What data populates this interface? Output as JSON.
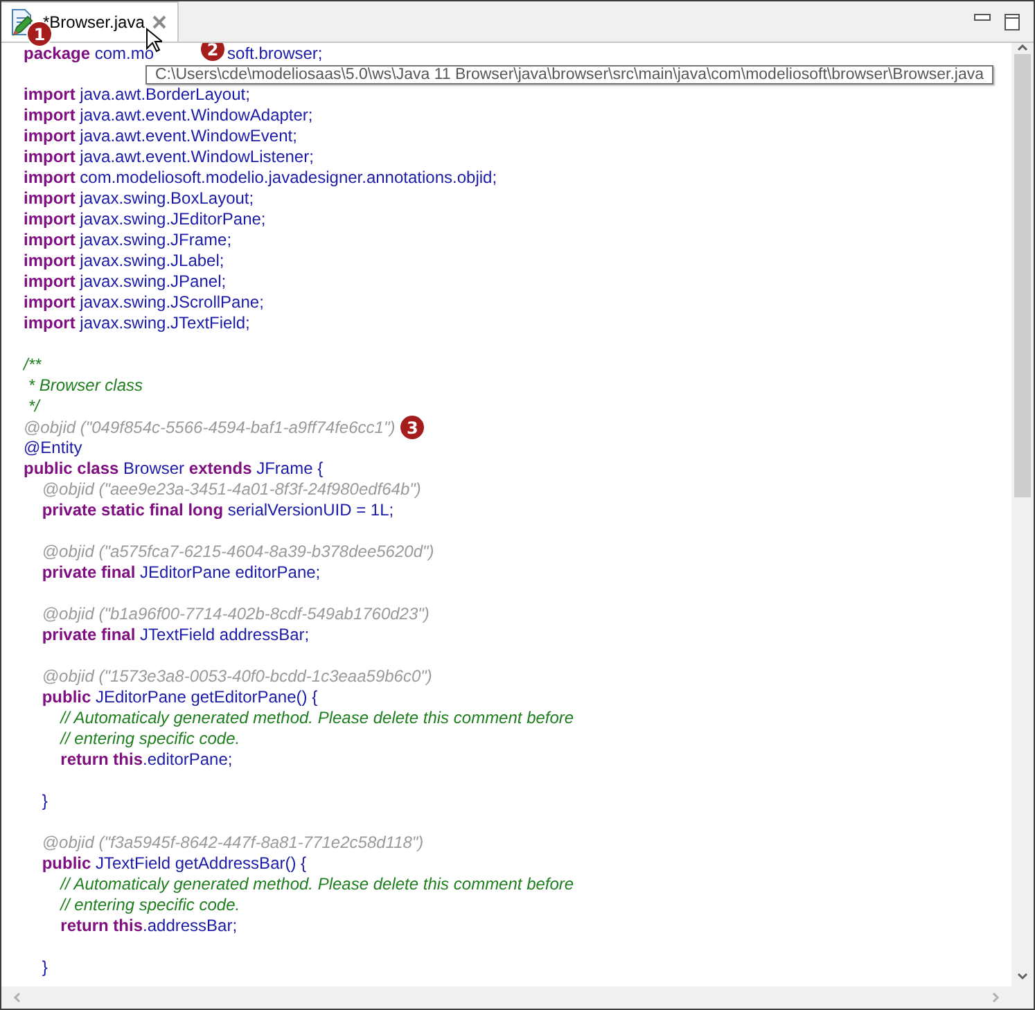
{
  "tab": {
    "title": "*Browser.java",
    "badge": "1"
  },
  "tooltip": {
    "text": "C:\\Users\\cde\\modeliosaas\\5.0\\ws\\Java 11 Browser\\java\\browser\\src\\main\\java\\com\\modeliosoft\\browser\\Browser.java"
  },
  "lines": [
    {
      "kind": "code",
      "tokens": [
        {
          "kind": "keyword",
          "text": "package"
        },
        {
          "kind": "plain",
          "text": " com.mo"
        },
        {
          "kind": "badge",
          "text": "2"
        },
        {
          "kind": "plain",
          "text": "soft.browser;"
        }
      ]
    },
    {
      "kind": "blank"
    },
    {
      "kind": "code",
      "tokens": [
        {
          "kind": "keyword",
          "text": "import"
        },
        {
          "kind": "plain",
          "text": " java.awt.BorderLayout;"
        }
      ]
    },
    {
      "kind": "code",
      "tokens": [
        {
          "kind": "keyword",
          "text": "import"
        },
        {
          "kind": "plain",
          "text": " java.awt.event.WindowAdapter;"
        }
      ]
    },
    {
      "kind": "code",
      "tokens": [
        {
          "kind": "keyword",
          "text": "import"
        },
        {
          "kind": "plain",
          "text": " java.awt.event.WindowEvent;"
        }
      ]
    },
    {
      "kind": "code",
      "tokens": [
        {
          "kind": "keyword",
          "text": "import"
        },
        {
          "kind": "plain",
          "text": " java.awt.event.WindowListener;"
        }
      ]
    },
    {
      "kind": "code",
      "tokens": [
        {
          "kind": "keyword",
          "text": "import"
        },
        {
          "kind": "plain",
          "text": " com.modeliosoft.modelio.javadesigner.annotations.objid;"
        }
      ]
    },
    {
      "kind": "code",
      "tokens": [
        {
          "kind": "keyword",
          "text": "import"
        },
        {
          "kind": "plain",
          "text": " javax.swing.BoxLayout;"
        }
      ]
    },
    {
      "kind": "code",
      "tokens": [
        {
          "kind": "keyword",
          "text": "import"
        },
        {
          "kind": "plain",
          "text": " javax.swing.JEditorPane;"
        }
      ]
    },
    {
      "kind": "code",
      "tokens": [
        {
          "kind": "keyword",
          "text": "import"
        },
        {
          "kind": "plain",
          "text": " javax.swing.JFrame;"
        }
      ]
    },
    {
      "kind": "code",
      "tokens": [
        {
          "kind": "keyword",
          "text": "import"
        },
        {
          "kind": "plain",
          "text": " javax.swing.JLabel;"
        }
      ]
    },
    {
      "kind": "code",
      "tokens": [
        {
          "kind": "keyword",
          "text": "import"
        },
        {
          "kind": "plain",
          "text": " javax.swing.JPanel;"
        }
      ]
    },
    {
      "kind": "code",
      "tokens": [
        {
          "kind": "keyword",
          "text": "import"
        },
        {
          "kind": "plain",
          "text": " javax.swing.JScrollPane;"
        }
      ]
    },
    {
      "kind": "code",
      "tokens": [
        {
          "kind": "keyword",
          "text": "import"
        },
        {
          "kind": "plain",
          "text": " javax.swing.JTextField;"
        }
      ]
    },
    {
      "kind": "blank"
    },
    {
      "kind": "code",
      "tokens": [
        {
          "kind": "comment",
          "text": "/**"
        }
      ]
    },
    {
      "kind": "code",
      "tokens": [
        {
          "kind": "comment",
          "text": " * Browser class"
        }
      ]
    },
    {
      "kind": "code",
      "tokens": [
        {
          "kind": "comment",
          "text": " */"
        }
      ]
    },
    {
      "kind": "code",
      "tokens": [
        {
          "kind": "annotation",
          "text": "@objid (\"049f854c-5566-4594-baf1-a9ff74fe6cc1\")"
        },
        {
          "kind": "badge",
          "text": "3"
        }
      ]
    },
    {
      "kind": "code",
      "tokens": [
        {
          "kind": "plain",
          "text": "@Entity"
        }
      ]
    },
    {
      "kind": "code",
      "tokens": [
        {
          "kind": "keyword",
          "text": "public class"
        },
        {
          "kind": "plain",
          "text": " Browser "
        },
        {
          "kind": "keyword",
          "text": "extends"
        },
        {
          "kind": "plain",
          "text": " JFrame {"
        }
      ]
    },
    {
      "kind": "code",
      "tokens": [
        {
          "kind": "annotation",
          "text": "    @objid (\"aee9e23a-3451-4a01-8f3f-24f980edf64b\")"
        }
      ]
    },
    {
      "kind": "code",
      "tokens": [
        {
          "kind": "keyword",
          "text": "    private static final long"
        },
        {
          "kind": "plain",
          "text": " serialVersionUID = 1L;"
        }
      ]
    },
    {
      "kind": "blank"
    },
    {
      "kind": "code",
      "tokens": [
        {
          "kind": "annotation",
          "text": "    @objid (\"a575fca7-6215-4604-8a39-b378dee5620d\")"
        }
      ]
    },
    {
      "kind": "code",
      "tokens": [
        {
          "kind": "keyword",
          "text": "    private final"
        },
        {
          "kind": "plain",
          "text": " JEditorPane editorPane;"
        }
      ]
    },
    {
      "kind": "blank"
    },
    {
      "kind": "code",
      "tokens": [
        {
          "kind": "annotation",
          "text": "    @objid (\"b1a96f00-7714-402b-8cdf-549ab1760d23\")"
        }
      ]
    },
    {
      "kind": "code",
      "tokens": [
        {
          "kind": "keyword",
          "text": "    private final"
        },
        {
          "kind": "plain",
          "text": " JTextField addressBar;"
        }
      ]
    },
    {
      "kind": "blank"
    },
    {
      "kind": "code",
      "tokens": [
        {
          "kind": "annotation",
          "text": "    @objid (\"1573e3a8-0053-40f0-bcdd-1c3eaa59b6c0\")"
        }
      ]
    },
    {
      "kind": "code",
      "tokens": [
        {
          "kind": "keyword",
          "text": "    public"
        },
        {
          "kind": "plain",
          "text": " JEditorPane getEditorPane() {"
        }
      ]
    },
    {
      "kind": "code",
      "tokens": [
        {
          "kind": "comment",
          "text": "        // Automaticaly generated method. Please delete this comment before"
        }
      ]
    },
    {
      "kind": "code",
      "tokens": [
        {
          "kind": "comment",
          "text": "        // entering specific code."
        }
      ]
    },
    {
      "kind": "code",
      "tokens": [
        {
          "kind": "keyword",
          "text": "        return this"
        },
        {
          "kind": "plain",
          "text": ".editorPane;"
        }
      ]
    },
    {
      "kind": "blank"
    },
    {
      "kind": "code",
      "tokens": [
        {
          "kind": "plain",
          "text": "    }"
        }
      ]
    },
    {
      "kind": "blank"
    },
    {
      "kind": "code",
      "tokens": [
        {
          "kind": "annotation",
          "text": "    @objid (\"f3a5945f-8642-447f-8a81-771e2c58d118\")"
        }
      ]
    },
    {
      "kind": "code",
      "tokens": [
        {
          "kind": "keyword",
          "text": "    public"
        },
        {
          "kind": "plain",
          "text": " JTextField getAddressBar() {"
        }
      ]
    },
    {
      "kind": "code",
      "tokens": [
        {
          "kind": "comment",
          "text": "        // Automaticaly generated method. Please delete this comment before"
        }
      ]
    },
    {
      "kind": "code",
      "tokens": [
        {
          "kind": "comment",
          "text": "        // entering specific code."
        }
      ]
    },
    {
      "kind": "code",
      "tokens": [
        {
          "kind": "keyword",
          "text": "        return this"
        },
        {
          "kind": "plain",
          "text": ".addressBar;"
        }
      ]
    },
    {
      "kind": "blank"
    },
    {
      "kind": "code",
      "tokens": [
        {
          "kind": "plain",
          "text": "    }"
        }
      ]
    }
  ]
}
